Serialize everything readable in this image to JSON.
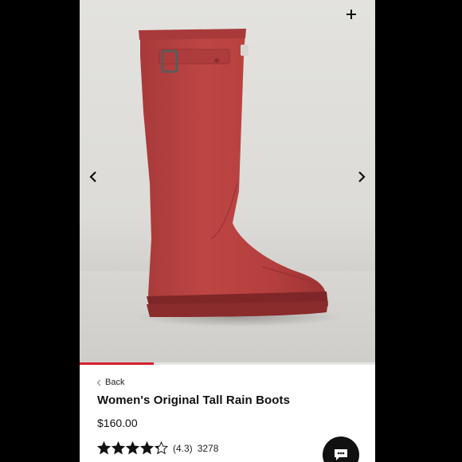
{
  "product": {
    "back_label": "Back",
    "title": "Women's Original Tall Rain Boots",
    "price": "$160.00",
    "rating_value": 4.3,
    "rating_text": "(4.3)",
    "review_count": "3278"
  },
  "gallery": {
    "progress_fraction": 0.25,
    "image_subject": "red tall rain boot",
    "icons": {
      "prev": "chevron-left-icon",
      "next": "chevron-right-icon",
      "expand": "plus-icon",
      "chat": "chat-bubble-icon"
    }
  },
  "colors": {
    "accent": "#d6202f",
    "boot": "#b8403f",
    "background": "#000000"
  }
}
